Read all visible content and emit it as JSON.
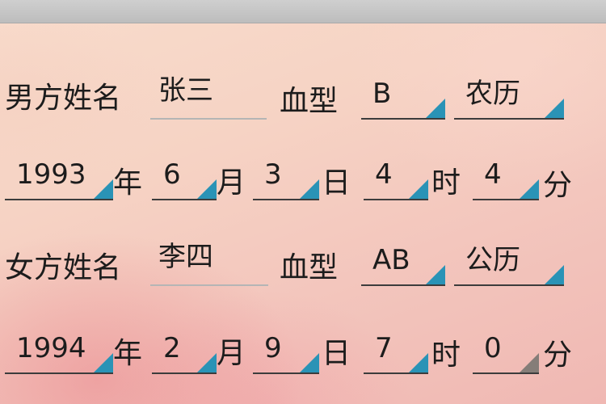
{
  "male": {
    "name_label": "男方姓名",
    "name_value": "张三",
    "blood_label": "血型",
    "blood_value": "B",
    "calendar_value": "农历",
    "year": "1993",
    "year_unit": "年",
    "month": "6",
    "month_unit": "月",
    "day": "3",
    "day_unit": "日",
    "hour": "4",
    "hour_unit": "时",
    "minute": "4",
    "minute_unit": "分"
  },
  "female": {
    "name_label": "女方姓名",
    "name_value": "李四",
    "blood_label": "血型",
    "blood_value": "AB",
    "calendar_value": "公历",
    "year": "1994",
    "year_unit": "年",
    "month": "2",
    "month_unit": "月",
    "day": "9",
    "day_unit": "日",
    "hour": "7",
    "hour_unit": "时",
    "minute": "0",
    "minute_unit": "分"
  },
  "colors": {
    "dropdown_arrow": "#2a93b6",
    "dropdown_arrow_disabled": "#857d78"
  }
}
